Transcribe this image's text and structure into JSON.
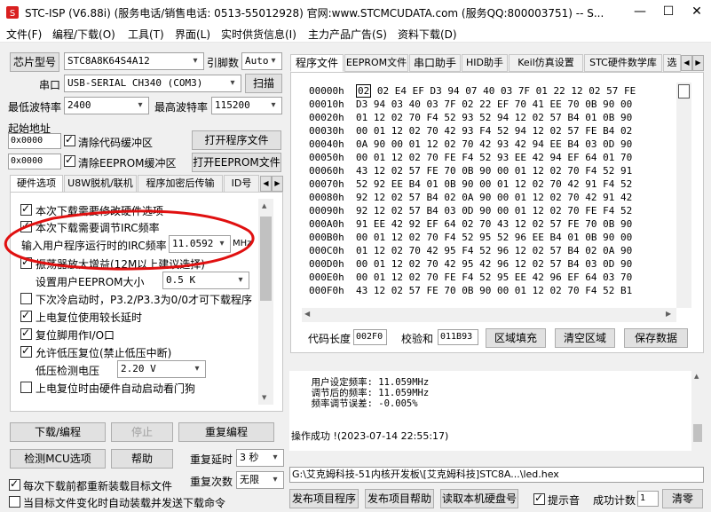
{
  "window": {
    "title": "STC-ISP (V6.88i) (服务电话/销售电话: 0513-55012928) 官网:www.STCMCUDATA.com  (服务QQ:800003751) -- S...",
    "minimize": "—",
    "maximize": "☐",
    "close": "✕"
  },
  "menu": [
    "文件(F)",
    "编程/下载(O)",
    "工具(T)",
    "界面(L)",
    "实时供货信息(I)",
    "主力产品广告(S)",
    "资料下载(D)"
  ],
  "chip": {
    "type_button": "芯片型号",
    "type_value": "STC8A8K64S4A12",
    "pins_label": "引脚数",
    "pins_value": "Auto",
    "port_label": "串口",
    "port_value": "USB-SERIAL CH340 (COM3)",
    "scan_button": "扫描",
    "min_baud_label": "最低波特率",
    "min_baud_value": "2400",
    "max_baud_label": "最高波特率",
    "max_baud_value": "115200",
    "start_addr_label": "起始地址",
    "addr1": "0x0000",
    "clear_code": "清除代码缓冲区",
    "open_program": "打开程序文件",
    "addr2": "0x0000",
    "clear_eeprom": "清除EEPROM缓冲区",
    "open_eeprom": "打开EEPROM文件"
  },
  "left_tabs": [
    "硬件选项",
    "U8W脱机/联机",
    "程序加密后传输",
    "ID号"
  ],
  "options": {
    "opt1": "本次下载需要修改硬件选项",
    "opt2": "本次下载需要调节IRC频率",
    "irc_label": "输入用户程序运行时的IRC频率",
    "irc_value": "11.0592",
    "irc_unit": "MHz",
    "opt3": "振荡器放大增益(12M以上建议选择)",
    "eeprom_label": "设置用户EEPROM大小",
    "eeprom_value": "0.5 K",
    "opt4": "下次冷启动时，P3.2/P3.3为0/0才可下载程序",
    "opt5": "上电复位使用较长延时",
    "opt6": "复位脚用作I/O口",
    "opt7": "允许低压复位(禁止低压中断)",
    "lvd_label": "低压检测电压",
    "lvd_value": "2.20 V",
    "opt8": "上电复位时由硬件自动启动看门狗"
  },
  "actions": {
    "download": "下载/编程",
    "stop": "停止",
    "reprogram": "重复编程",
    "detect": "检测MCU选项",
    "help": "帮助",
    "repeat_delay_label": "重复延时",
    "repeat_delay_value": "3 秒",
    "repeat_count_label": "重复次数",
    "repeat_count_value": "无限",
    "reload_each": "每次下载前都重新装载目标文件",
    "auto_send": "当目标文件变化时自动装载并发送下载命令"
  },
  "right_tabs": [
    "程序文件",
    "EEPROM文件",
    "串口助手",
    "HID助手",
    "Keil仿真设置",
    "STC硬件数学库",
    "选"
  ],
  "hex": [
    {
      "addr": "00000h",
      "bytes": "02 02 E4 EF D3 94 07 40 03 7F 01 22 12 02 57 FE"
    },
    {
      "addr": "00010h",
      "bytes": "D3 94 03 40 03 7F 02 22 EF 70 41 EE 70 0B 90 00"
    },
    {
      "addr": "00020h",
      "bytes": "01 12 02 70 F4 52 93 52 94 12 02 57 B4 01 0B 90"
    },
    {
      "addr": "00030h",
      "bytes": "00 01 12 02 70 42 93 F4 52 94 12 02 57 FE B4 02"
    },
    {
      "addr": "00040h",
      "bytes": "0A 90 00 01 12 02 70 42 93 42 94 EE B4 03 0D 90"
    },
    {
      "addr": "00050h",
      "bytes": "00 01 12 02 70 FE F4 52 93 EE 42 94 EF 64 01 70"
    },
    {
      "addr": "00060h",
      "bytes": "43 12 02 57 FE 70 0B 90 00 01 12 02 70 F4 52 91"
    },
    {
      "addr": "00070h",
      "bytes": "52 92 EE B4 01 0B 90 00 01 12 02 70 42 91 F4 52"
    },
    {
      "addr": "00080h",
      "bytes": "92 12 02 57 B4 02 0A 90 00 01 12 02 70 42 91 42"
    },
    {
      "addr": "00090h",
      "bytes": "92 12 02 57 B4 03 0D 90 00 01 12 02 70 FE F4 52"
    },
    {
      "addr": "000A0h",
      "bytes": "91 EE 42 92 EF 64 02 70 43 12 02 57 FE 70 0B 90"
    },
    {
      "addr": "000B0h",
      "bytes": "00 01 12 02 70 F4 52 95 52 96 EE B4 01 0B 90 00"
    },
    {
      "addr": "000C0h",
      "bytes": "01 12 02 70 42 95 F4 52 96 12 02 57 B4 02 0A 90"
    },
    {
      "addr": "000D0h",
      "bytes": "00 01 12 02 70 42 95 42 96 12 02 57 B4 03 0D 90"
    },
    {
      "addr": "000E0h",
      "bytes": "00 01 12 02 70 FE F4 52 95 EE 42 96 EF 64 03 70"
    },
    {
      "addr": "000F0h",
      "bytes": "43 12 02 57 FE 70 0B 90 00 01 12 02 70 F4 52 B1"
    }
  ],
  "code_bar": {
    "length_label": "代码长度",
    "length_value": "002F0",
    "checksum_label": "校验和",
    "checksum_value": "011B93",
    "fill_button": "区域填充",
    "clear_button": "清空区域",
    "save_button": "保存数据"
  },
  "log": {
    "line1": "  用户设定频率: 11.059MHz",
    "line2": "  调节后的频率: 11.059MHz",
    "line3": "  频率调节误差: -0.005%",
    "done": "操作成功 !(2023-07-14 22:55:17)"
  },
  "file_path": "G:\\艾克姆科技-51内核开发板\\[艾克姆科技]STC8A...\\led.hex",
  "bottom": {
    "publish_program": "发布项目程序",
    "publish_help": "发布项目帮助",
    "read_disk": "读取本机硬盘号",
    "beep": "提示音",
    "success_count_label": "成功计数",
    "success_count_value": "1",
    "clear": "清零"
  }
}
